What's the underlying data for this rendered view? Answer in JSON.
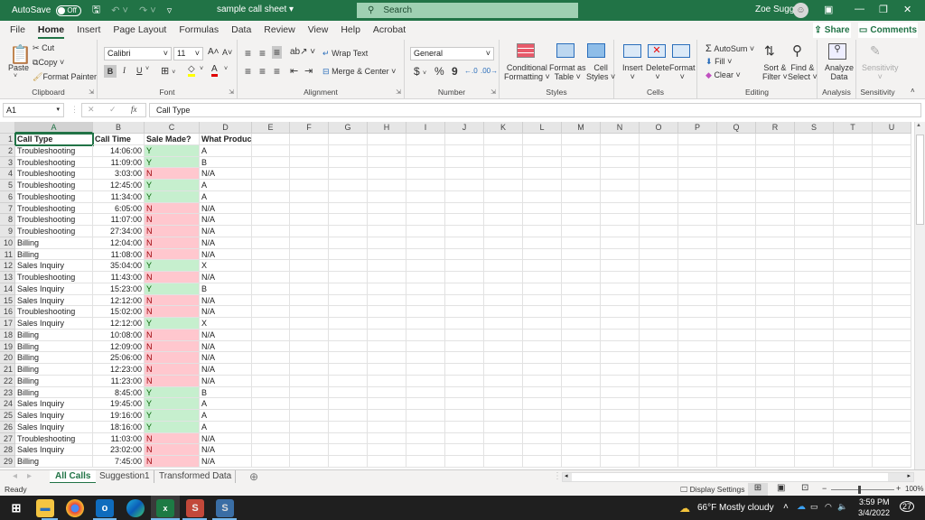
{
  "titlebar": {
    "autosave_label": "AutoSave",
    "autosave_state": "Off",
    "document_title": "sample call sheet",
    "search_placeholder": "Search",
    "user_name": "Zoe Sugg",
    "accent_color": "#217346"
  },
  "menu": {
    "tabs": [
      "File",
      "Home",
      "Insert",
      "Page Layout",
      "Formulas",
      "Data",
      "Review",
      "View",
      "Help",
      "Acrobat"
    ],
    "active_tab": "Home",
    "share_label": "Share",
    "comments_label": "Comments"
  },
  "ribbon": {
    "clipboard": {
      "paste": "Paste",
      "cut": "Cut",
      "copy": "Copy",
      "format_painter": "Format Painter",
      "label": "Clipboard"
    },
    "font": {
      "font_name": "Calibri",
      "font_size": "11",
      "bold": "B",
      "italic": "I",
      "underline": "U",
      "label": "Font"
    },
    "alignment": {
      "wrap_text": "Wrap Text",
      "merge_center": "Merge & Center",
      "label": "Alignment"
    },
    "number": {
      "format": "General",
      "currency": "$",
      "percent": "%",
      "comma": "9",
      "label": "Number"
    },
    "styles": {
      "conditional_formatting": "Conditional Formatting",
      "format_as_table": "Format as Table",
      "cell_styles": "Cell Styles",
      "label": "Styles"
    },
    "cells": {
      "insert": "Insert",
      "delete": "Delete",
      "format": "Format",
      "label": "Cells"
    },
    "editing": {
      "autosum": "AutoSum",
      "fill": "Fill",
      "clear": "Clear",
      "sort_filter": "Sort & Filter",
      "find_select": "Find & Select",
      "label": "Editing"
    },
    "analysis": {
      "analyze_data": "Analyze Data",
      "label": "Analysis"
    },
    "sensitivity": {
      "sensitivity": "Sensitivity",
      "label": "Sensitivity"
    }
  },
  "formula_bar": {
    "name_box": "A1",
    "fx": "fx",
    "formula": "Call Type"
  },
  "sheet": {
    "columns": [
      "A",
      "B",
      "C",
      "D",
      "E",
      "F",
      "G",
      "H",
      "I",
      "J",
      "K",
      "L",
      "M",
      "N",
      "O",
      "P",
      "Q",
      "R",
      "S",
      "T",
      "U"
    ],
    "headers": [
      "Call Type",
      "Call Time",
      "Sale Made?",
      "What Product?"
    ],
    "rows": [
      [
        "Troubleshooting",
        "14:06:00",
        "Y",
        "A"
      ],
      [
        "Troubleshooting",
        "11:09:00",
        "Y",
        "B"
      ],
      [
        "Troubleshooting",
        "3:03:00",
        "N",
        "N/A"
      ],
      [
        "Troubleshooting",
        "12:45:00",
        "Y",
        "A"
      ],
      [
        "Troubleshooting",
        "11:34:00",
        "Y",
        "A"
      ],
      [
        "Troubleshooting",
        "6:05:00",
        "N",
        "N/A"
      ],
      [
        "Troubleshooting",
        "11:07:00",
        "N",
        "N/A"
      ],
      [
        "Troubleshooting",
        "27:34:00",
        "N",
        "N/A"
      ],
      [
        "Billing",
        "12:04:00",
        "N",
        "N/A"
      ],
      [
        "Billing",
        "11:08:00",
        "N",
        "N/A"
      ],
      [
        "Sales Inquiry",
        "35:04:00",
        "Y",
        "X"
      ],
      [
        "Troubleshooting",
        "11:43:00",
        "N",
        "N/A"
      ],
      [
        "Sales Inquiry",
        "15:23:00",
        "Y",
        "B"
      ],
      [
        "Sales Inquiry",
        "12:12:00",
        "N",
        "N/A"
      ],
      [
        "Troubleshooting",
        "15:02:00",
        "N",
        "N/A"
      ],
      [
        "Sales Inquiry",
        "12:12:00",
        "Y",
        "X"
      ],
      [
        "Billing",
        "10:08:00",
        "N",
        "N/A"
      ],
      [
        "Billing",
        "12:09:00",
        "N",
        "N/A"
      ],
      [
        "Billing",
        "25:06:00",
        "N",
        "N/A"
      ],
      [
        "Billing",
        "12:23:00",
        "N",
        "N/A"
      ],
      [
        "Billing",
        "11:23:00",
        "N",
        "N/A"
      ],
      [
        "Billing",
        "8:45:00",
        "Y",
        "B"
      ],
      [
        "Sales Inquiry",
        "19:45:00",
        "Y",
        "A"
      ],
      [
        "Sales Inquiry",
        "19:16:00",
        "Y",
        "A"
      ],
      [
        "Sales Inquiry",
        "18:16:00",
        "Y",
        "A"
      ],
      [
        "Troubleshooting",
        "11:03:00",
        "N",
        "N/A"
      ],
      [
        "Sales Inquiry",
        "23:02:00",
        "N",
        "N/A"
      ],
      [
        "Billing",
        "7:45:00",
        "N",
        "N/A"
      ]
    ],
    "colors": {
      "yes_fill": "#c6efce",
      "yes_text": "#006100",
      "no_fill": "#ffc7ce",
      "no_text": "#9c0006"
    }
  },
  "sheet_tabs": [
    "All Calls",
    "Suggestion1",
    "Transformed Data"
  ],
  "active_sheet": "All Calls",
  "status": {
    "ready": "Ready",
    "display_settings": "Display Settings",
    "zoom": "100%"
  },
  "taskbar": {
    "weather": "66°F  Mostly cloudy",
    "time": "3:59 PM",
    "date": "3/4/2022",
    "notifications": "27"
  }
}
